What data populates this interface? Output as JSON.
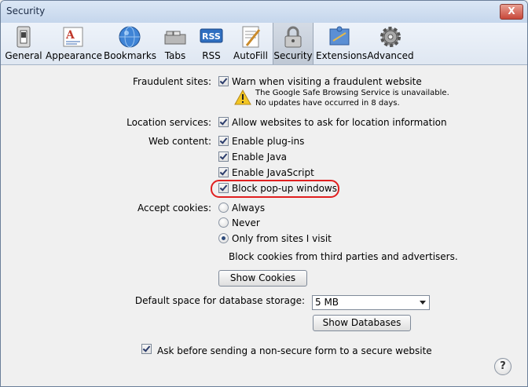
{
  "window": {
    "title": "Security",
    "close_label": "X"
  },
  "toolbar": {
    "items": [
      {
        "label": "General",
        "icon": "switch-icon"
      },
      {
        "label": "Appearance",
        "icon": "font-icon"
      },
      {
        "label": "Bookmarks",
        "icon": "globe-icon"
      },
      {
        "label": "Tabs",
        "icon": "tabs-icon"
      },
      {
        "label": "RSS",
        "icon": "rss-icon"
      },
      {
        "label": "AutoFill",
        "icon": "pen-paper-icon"
      },
      {
        "label": "Security",
        "icon": "padlock-icon",
        "selected": true
      },
      {
        "label": "Extensions",
        "icon": "puzzle-icon"
      },
      {
        "label": "Advanced",
        "icon": "gear-icon"
      }
    ]
  },
  "security": {
    "fraudulent": {
      "label": "Fraudulent sites:",
      "checkbox": "Warn when visiting a fraudulent website",
      "checked": true,
      "warning_line1": "The Google Safe Browsing Service is unavailable.",
      "warning_line2": "No updates have occurred in 8 days."
    },
    "location": {
      "label": "Location services:",
      "checkbox": "Allow websites to ask for location information",
      "checked": true
    },
    "web_content": {
      "label": "Web content:",
      "options": [
        {
          "text": "Enable plug-ins",
          "checked": true
        },
        {
          "text": "Enable Java",
          "checked": true
        },
        {
          "text": "Enable JavaScript",
          "checked": true
        },
        {
          "text": "Block pop-up windows",
          "checked": true
        }
      ]
    },
    "cookies": {
      "label": "Accept cookies:",
      "options": [
        "Always",
        "Never",
        "Only from sites I visit"
      ],
      "selected": "Only from sites I visit",
      "note": "Block cookies from third parties and advertisers.",
      "button": "Show Cookies"
    },
    "database": {
      "label": "Default space for database storage:",
      "value": "5 MB",
      "button": "Show Databases"
    },
    "nonsecure": {
      "checkbox": "Ask before sending a non-secure form to a secure website",
      "checked": true
    },
    "help": "?"
  }
}
